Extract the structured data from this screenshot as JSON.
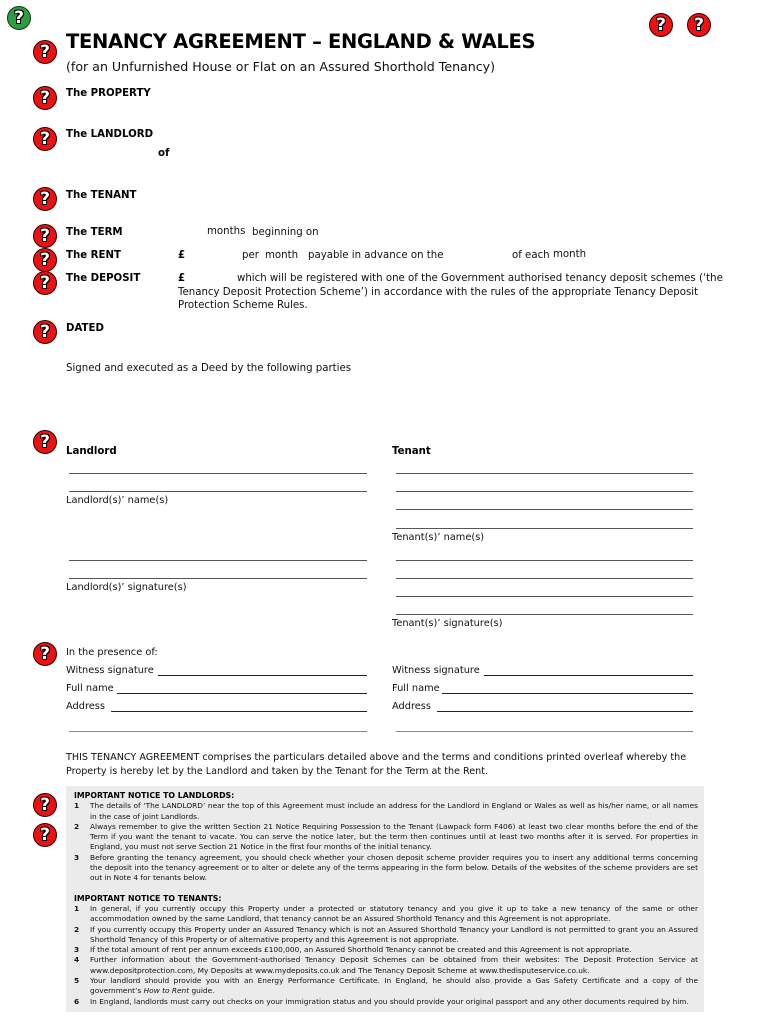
{
  "header": {
    "title": "TENANCY AGREEMENT – ENGLAND & WALES",
    "subtitle": "(for an Unfurnished House or Flat on an Assured Shorthold Tenancy)"
  },
  "icons": {
    "help_glyph": "?",
    "help_color": "#ee1111",
    "help_green_color": "#2e9e44"
  },
  "particulars": {
    "property_label": "The PROPERTY",
    "landlord_label": "The LANDLORD",
    "landlord_of": "of",
    "tenant_label": "The TENANT",
    "term_label": "The TERM",
    "term_months": "months",
    "term_beginning": "beginning on",
    "rent_label": "The RENT",
    "rent_currency": "£",
    "rent_per": "per",
    "rent_period": "month",
    "rent_payable": "payable in advance on the",
    "rent_of_each": "of each",
    "rent_each_period": "month",
    "deposit_label": "The DEPOSIT",
    "deposit_currency": "£",
    "deposit_text_1": "which will be registered with one of the Government authorised tenancy deposit schemes (‘the",
    "deposit_text_2": "Tenancy Deposit Protection Scheme’) in accordance with the rules of the appropriate Tenancy Deposit",
    "deposit_text_3": "Protection Scheme Rules.",
    "dated_label": "DATED"
  },
  "signing": {
    "intro": "Signed and executed as a Deed by the following parties",
    "landlord_heading": "Landlord",
    "tenant_heading": "Tenant",
    "landlord_names": "Landlord(s)’ name(s)",
    "landlord_signatures": "Landlord(s)’ signature(s)",
    "tenant_names": "Tenant(s)’ name(s)",
    "tenant_signatures": "Tenant(s)’ signature(s)"
  },
  "witness": {
    "presence": "In the presence of:",
    "signature_label": "Witness signature",
    "full_name_label": "Full name",
    "address_label": "Address"
  },
  "statement": {
    "line_1": "THIS TENANCY AGREEMENT comprises the particulars detailed above and the terms and conditions printed overleaf whereby the",
    "line_2": "Property is hereby let by the Landlord and taken by the Tenant for the Term at the Rent."
  },
  "notices": {
    "landlords_heading": "IMPORTANT NOTICE TO LANDLORDS:",
    "landlords_items": [
      {
        "num": "1",
        "text": "The details of ‘The LANDLORD’ near the top of this Agreement must include an address for the Landlord in England or Wales as well as his/her name, or all names in the case of joint Landlords."
      },
      {
        "num": "2",
        "text": "Always remember to give the written Section 21 Notice Requiring Possession to the Tenant (Lawpack form F406) at least two clear months before the end of the Term if you want the tenant to vacate. You can serve the notice later, but the term then continues until at least two months after it is served.  For properties in England, you must not serve Section 21 Notice in the first four months of the initial tenancy."
      },
      {
        "num": "3",
        "text": "Before granting the tenancy agreement, you should check whether your chosen deposit scheme provider requires you to insert any additional terms concerning the deposit into the tenancy agreement or to alter or delete any of the terms appearing in the form below. Details of the websites of the scheme providers are set out in Note 4 for tenants below."
      }
    ],
    "tenants_heading": "IMPORTANT NOTICE TO TENANTS:",
    "tenants_items": [
      {
        "num": "1",
        "text": "In general, if you currently occupy this Property under a protected or statutory tenancy and you give it up to take a new tenancy of the same or other accommodation owned by the same Landlord, that tenancy cannot be an Assured Shorthold Tenancy and this Agreement is not appropriate."
      },
      {
        "num": "2",
        "text": "If you currently occupy this Property under an Assured Tenancy which is not an Assured Shorthold Tenancy your Landlord is not permitted to grant you an Assured Shorthold Tenancy of this Property or of alternative property and this Agreement is not appropriate."
      },
      {
        "num": "3",
        "text": "If the total amount of rent per annum exceeds £100,000, an Assured Shorthold Tenancy cannot be created and this Agreement is not appropriate."
      },
      {
        "num": "4",
        "text": "Further information about the Government-authorised Tenancy Deposit Schemes can be obtained from their websites: The Deposit Protection Service at www.depositprotection.com, My Deposits at www.mydeposits.co.uk and The Tenancy Deposit Scheme at www.thedisputeservice.co.uk."
      },
      {
        "num": "5",
        "text_before": "Your landlord should provide you with an Energy Performance Certificate. In England, he should also provide a Gas Safety Certificate and a copy of the government’s ",
        "text_italic": "How to Rent",
        "text_after": " guide."
      },
      {
        "num": "6",
        "text": "In England, landlords must carry out checks on your immigration status and you should provide your original passport and any other documents required by him."
      }
    ]
  }
}
